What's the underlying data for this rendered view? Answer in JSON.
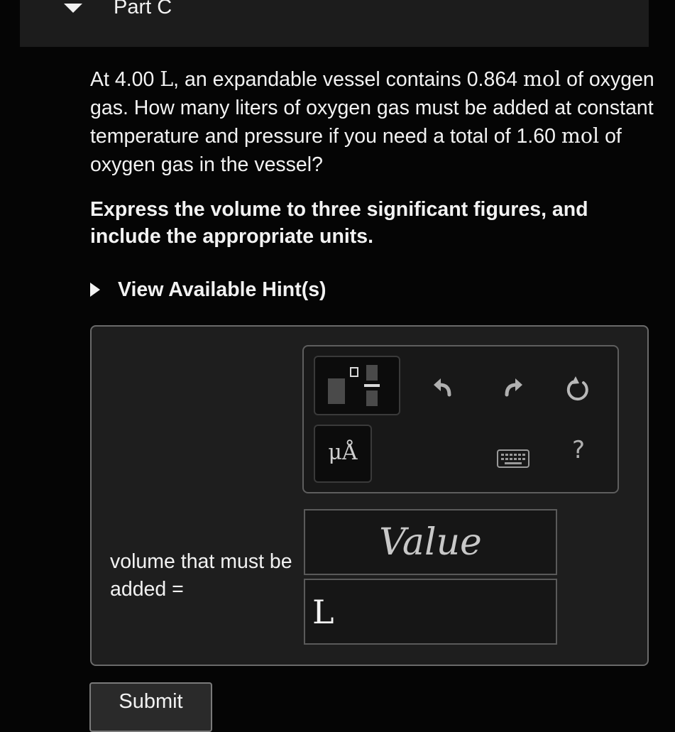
{
  "part": {
    "title": "Part C",
    "toggle_icon": "caret-down-icon"
  },
  "question": {
    "t1": "At 4.00 ",
    "u1": "L",
    "t2": ", an expandable vessel contains 0.864 ",
    "u2": "mol",
    "t3": " of oxygen gas. How many liters of oxygen gas must be added at constant temperature and pressure if you need a total of 1.60 ",
    "u3": "mol",
    "t4": " of oxygen gas in the vessel?"
  },
  "instructions": "Express the volume to three significant figures, and include the appropriate units.",
  "hints": {
    "label": "View Available Hint(s)",
    "icon": "caret-right-icon"
  },
  "toolbar": {
    "templates_icon": "fraction-template-icon",
    "undo_icon": "undo-icon",
    "redo_icon": "redo-icon",
    "reset_icon": "reset-icon",
    "units_label": "μÅ",
    "keyboard_icon": "keyboard-icon",
    "help_label": "?"
  },
  "answer": {
    "label": "volume that must be added =",
    "value_placeholder": "Value",
    "value": "",
    "unit": "L"
  },
  "submit_label": "Submit"
}
